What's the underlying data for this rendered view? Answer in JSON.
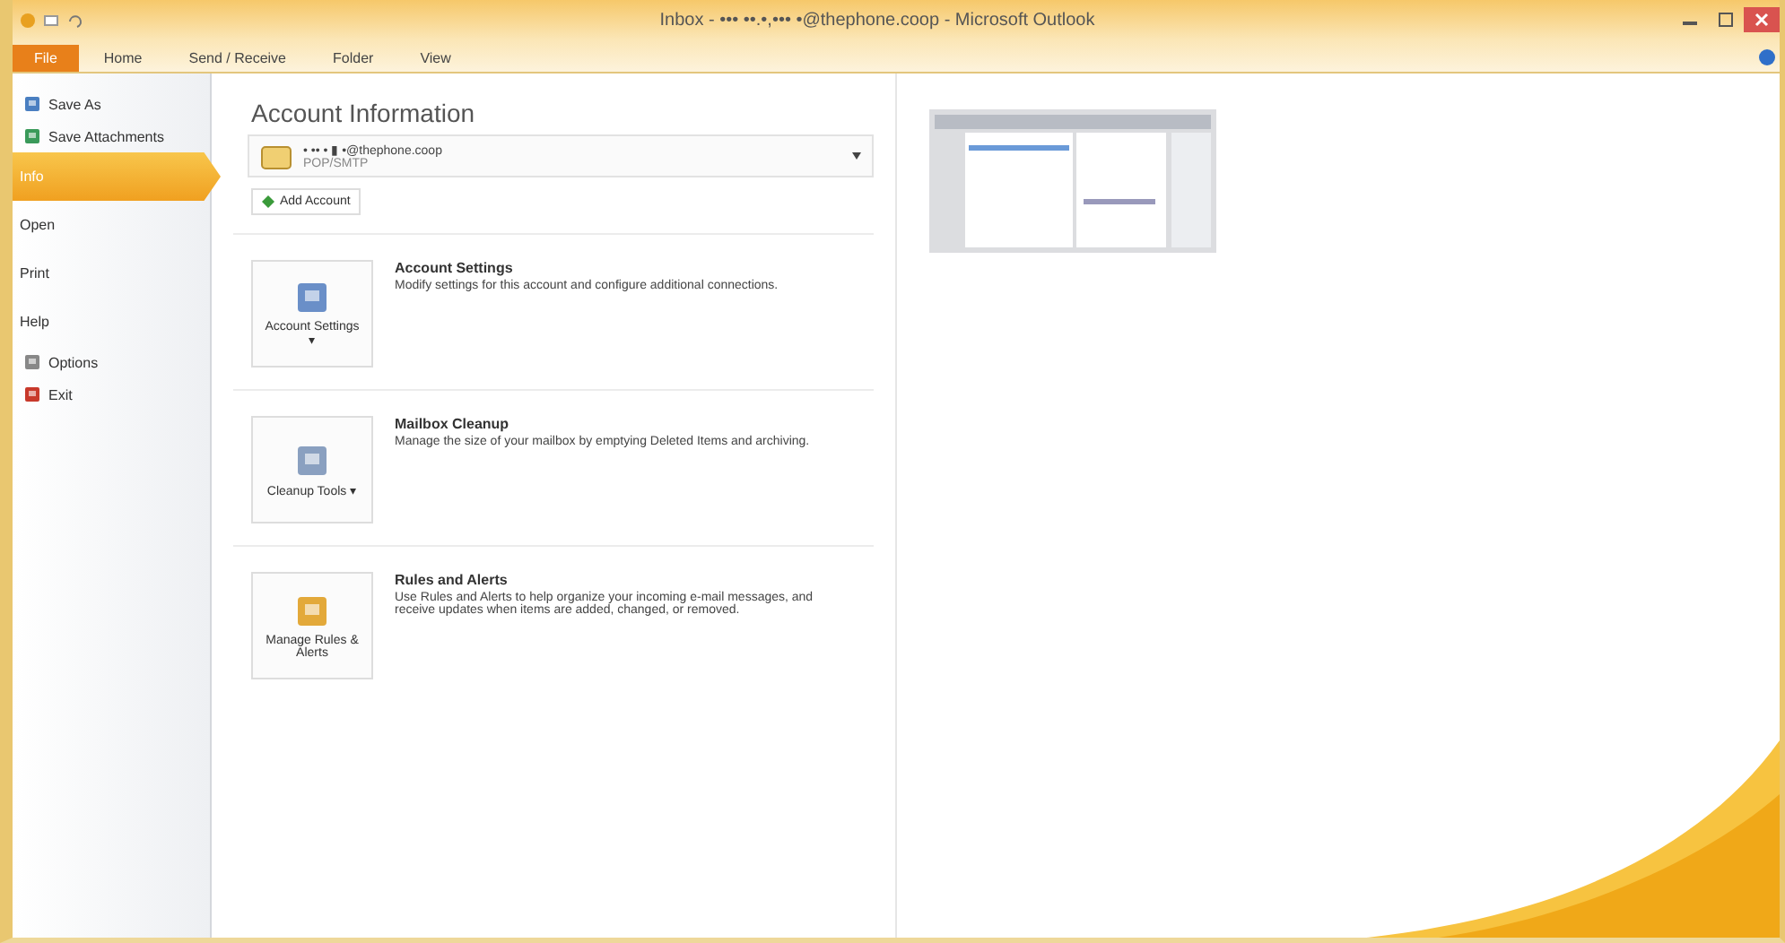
{
  "window": {
    "title": "Inbox - ••• ••.•,••• •@thephone.coop - Microsoft Outlook"
  },
  "tabs": [
    {
      "label": "File",
      "selected": true
    },
    {
      "label": "Home",
      "selected": false
    },
    {
      "label": "Send / Receive",
      "selected": false
    },
    {
      "label": "Folder",
      "selected": false
    },
    {
      "label": "View",
      "selected": false
    }
  ],
  "sidebar": {
    "items": [
      {
        "label": "Save As",
        "kind": "command",
        "selected": false
      },
      {
        "label": "Save Attachments",
        "kind": "command",
        "selected": false
      },
      {
        "label": "Info",
        "kind": "page",
        "selected": true
      },
      {
        "label": "Open",
        "kind": "page",
        "selected": false
      },
      {
        "label": "Print",
        "kind": "page",
        "selected": false
      },
      {
        "label": "Help",
        "kind": "page",
        "selected": false
      },
      {
        "label": "Options",
        "kind": "command",
        "selected": false
      },
      {
        "label": "Exit",
        "kind": "command",
        "selected": false
      }
    ]
  },
  "info": {
    "heading": "Account Information",
    "account": {
      "address": "• •• • ▮ •@thephone.coop",
      "type": "POP/SMTP"
    },
    "add_account": "Add Account",
    "sections": [
      {
        "button": "Account Settings ▾",
        "title": "Account Settings",
        "description": "Modify settings for this account and configure additional connections."
      },
      {
        "button": "Cleanup Tools ▾",
        "title": "Mailbox Cleanup",
        "description": "Manage the size of your mailbox by emptying Deleted Items and archiving."
      },
      {
        "button": "Manage Rules & Alerts",
        "title": "Rules and Alerts",
        "description": "Use Rules and Alerts to help organize your incoming e-mail messages, and receive updates when items are added, changed, or removed."
      }
    ]
  }
}
